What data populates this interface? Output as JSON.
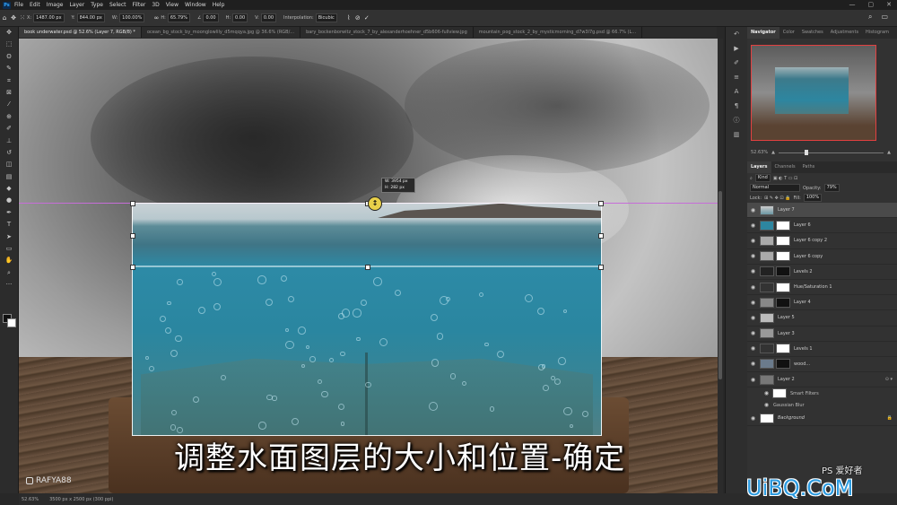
{
  "app": {
    "logo_text": "Ps"
  },
  "menu": [
    "File",
    "Edit",
    "Image",
    "Layer",
    "Type",
    "Select",
    "Filter",
    "3D",
    "View",
    "Window",
    "Help"
  ],
  "window_controls": [
    "—",
    "▢",
    "✕"
  ],
  "options": {
    "x_label": "X:",
    "x_value": "1487.00 px",
    "y_label": "Y:",
    "y_value": "844.00 px",
    "w_label": "W:",
    "w_value": "100.00%",
    "h_label": "H:",
    "h_value": "65.79%",
    "angle_value": "0.00",
    "hskew_label": "H:",
    "hskew_value": "0.00",
    "vskew_label": "V:",
    "vskew_value": "0.00",
    "interp_label": "Interpolation:",
    "interp_value": "Bicubic",
    "cancel_icon": "⃠",
    "commit_icon": "✓"
  },
  "tabs": [
    "book underwater.psd @ 52.6% (Layer 7, RGB/8) *",
    "ocean_bg_stock_by_moonglowlily_d5mqqya.jpg @ 36.6% (RGB/...",
    "bary_bockenborwitz_stock_7_by_alexanderhoehner_d5b606-fullview.jpg",
    "mountain_pog_stock_2_by_mysticmorning_d7w3l7g.psd @ 66.7% (L..."
  ],
  "tooltip": {
    "line1": "W: 3954 px",
    "line2": "H: 282 px"
  },
  "subtitle": "调整水面图层的大小和位置-确定",
  "watermark": "RAFYA88",
  "status": {
    "zoom": "52.63%",
    "doc": "3500 px x 2500 px (300 ppi)"
  },
  "panels": {
    "top_tabs": [
      "Navigator",
      "Color",
      "Swatches",
      "Adjustments",
      "Histogram"
    ],
    "nav_zoom": "52.63%",
    "layer_tabs": [
      "Layers",
      "Channels",
      "Paths"
    ],
    "kind_label": "Kind",
    "blend_mode": "Normal",
    "opacity_label": "Opacity:",
    "opacity_value": "79%",
    "lock_label": "Lock:",
    "fill_label": "Fill:",
    "fill_value": "100%",
    "layers": [
      {
        "name": "Layer 7",
        "selected": true
      },
      {
        "name": "Layer 6"
      },
      {
        "name": "Layer 6 copy 2"
      },
      {
        "name": "Layer 6 copy"
      },
      {
        "name": "Levels 2"
      },
      {
        "name": "Hue/Saturation 1"
      },
      {
        "name": "Layer 4"
      },
      {
        "name": "Layer 5"
      },
      {
        "name": "Layer 3"
      },
      {
        "name": "Levels 1"
      },
      {
        "name": "wood..."
      },
      {
        "name": "Layer 2"
      }
    ],
    "smart_filters": "Smart Filters",
    "gaussian_blur": "Gaussian Blur",
    "background": "Background"
  },
  "site_logo": "UiBQ.CoM",
  "ps_stamp": "PS 爱好者"
}
